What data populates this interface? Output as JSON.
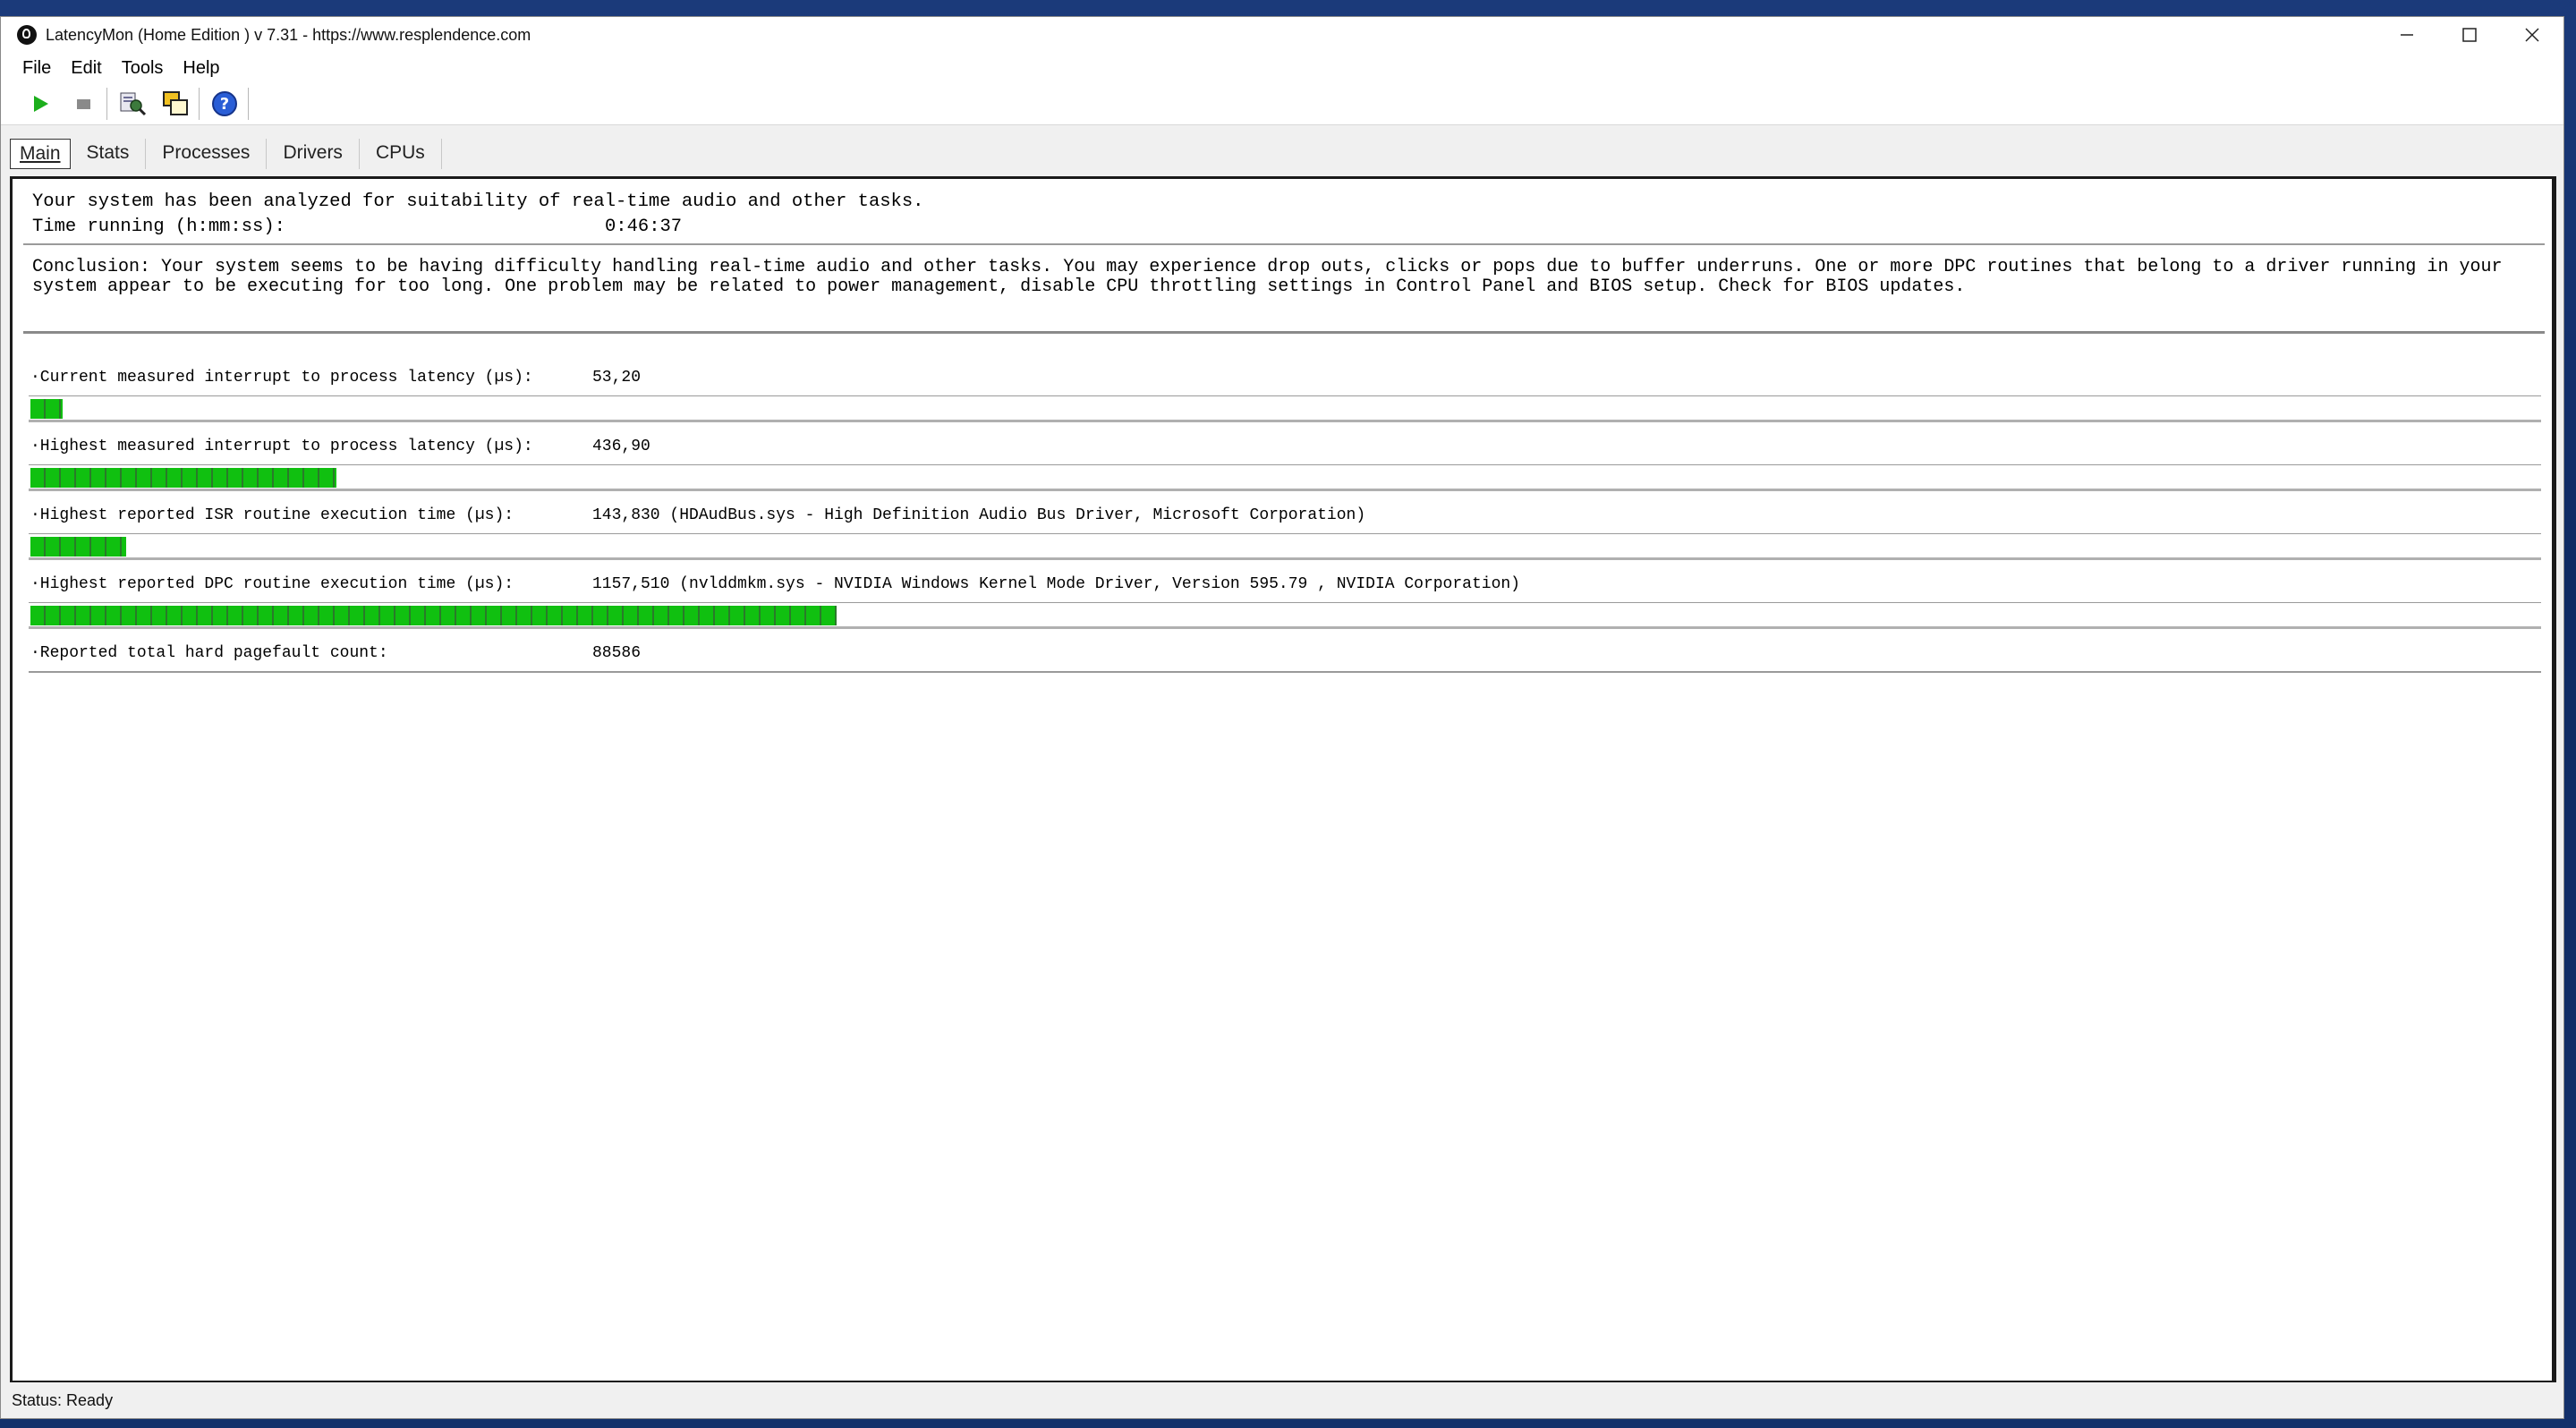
{
  "window": {
    "title": "LatencyMon  (Home Edition )  v 7.31 - https://www.resplendence.com",
    "controls": {
      "minimize": "—",
      "maximize": "☐",
      "close": "✕"
    }
  },
  "menu": {
    "items": [
      "File",
      "Edit",
      "Tools",
      "Help"
    ]
  },
  "toolbar": {
    "icons": [
      "play-icon",
      "stop-icon",
      "search-report-icon",
      "copy-windows-icon",
      "help-icon"
    ]
  },
  "tabs": [
    "Main",
    "Stats",
    "Processes",
    "Drivers",
    "CPUs"
  ],
  "analysis": {
    "line1": "Your system has been analyzed for suitability of real-time audio and other tasks.",
    "time_label": "Time running (h:mm:ss):",
    "time_value": "0:46:37"
  },
  "conclusion": "Conclusion: Your system seems to be having difficulty handling real-time audio and other tasks. You may experience drop outs, clicks or pops due to buffer underruns. One or more DPC routines that belong to a driver running in your system appear to be executing for too long. One problem may be related to power management, disable CPU throttling settings in Control Panel and BIOS setup. Check for BIOS updates.",
  "metrics": [
    {
      "label": "·Current measured interrupt to process latency (µs):",
      "value": "53,20",
      "bar_fraction": 0.013
    },
    {
      "label": "·Highest measured interrupt to process latency (µs):",
      "value": "436,90",
      "bar_fraction": 0.122
    },
    {
      "label": "·Highest reported ISR routine execution time (µs):",
      "value": "143,830  (HDAudBus.sys - High Definition Audio Bus Driver, Microsoft Corporation)",
      "bar_fraction": 0.038
    },
    {
      "label": "·Highest reported DPC routine execution time (µs):",
      "value": "1157,510  (nvlddmkm.sys - NVIDIA Windows Kernel Mode Driver, Version 595.79 , NVIDIA Corporation)",
      "bar_fraction": 0.321
    },
    {
      "label": "·Reported total hard pagefault count:",
      "value": "88586"
    }
  ],
  "colors": {
    "bar_green": "#10c010",
    "bar_divider": "#2a7a2a"
  },
  "status": "Status: Ready"
}
